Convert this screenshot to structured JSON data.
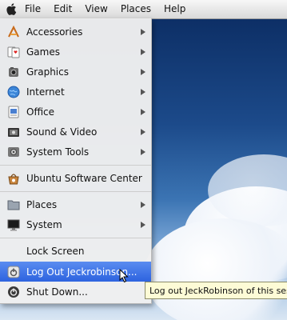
{
  "menubar": {
    "items": [
      "File",
      "Edit",
      "View",
      "Places",
      "Help"
    ]
  },
  "menu": {
    "items": [
      {
        "label": "Accessories",
        "icon": "accessories-icon",
        "submenu": true
      },
      {
        "label": "Games",
        "icon": "games-icon",
        "submenu": true
      },
      {
        "label": "Graphics",
        "icon": "graphics-icon",
        "submenu": true
      },
      {
        "label": "Internet",
        "icon": "internet-icon",
        "submenu": true
      },
      {
        "label": "Office",
        "icon": "office-icon",
        "submenu": true
      },
      {
        "label": "Sound & Video",
        "icon": "sound-video-icon",
        "submenu": true
      },
      {
        "label": "System Tools",
        "icon": "system-tools-icon",
        "submenu": true
      },
      {
        "label": "Ubuntu Software Center",
        "icon": "software-center-icon",
        "submenu": false
      },
      {
        "label": "Places",
        "icon": "folder-icon",
        "submenu": true
      },
      {
        "label": "System",
        "icon": "monitor-icon",
        "submenu": true
      },
      {
        "label": "Lock Screen",
        "icon": "",
        "submenu": false
      },
      {
        "label": "Log Out Jeckrobinson...",
        "icon": "logout-icon",
        "submenu": false,
        "active": true
      },
      {
        "label": "Shut Down...",
        "icon": "power-icon",
        "submenu": false
      }
    ]
  },
  "tooltip": {
    "text": "Log out JeckRobinson of this ses"
  },
  "colors": {
    "highlight": "#3a6fe3",
    "tooltip_bg": "#fdfbd6"
  }
}
